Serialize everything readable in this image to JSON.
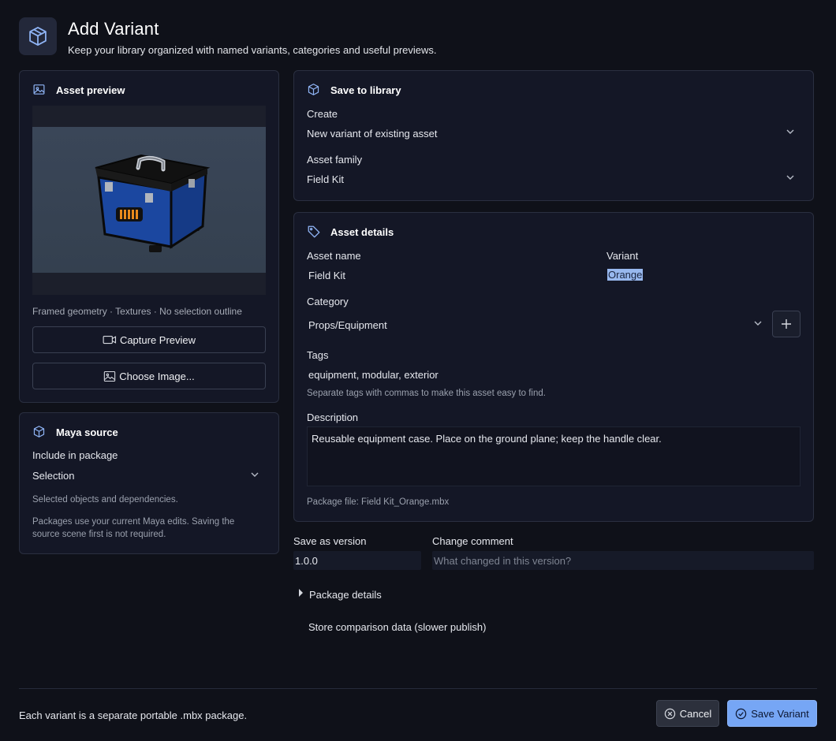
{
  "header": {
    "title": "Add Variant",
    "subtitle": "Keep your library organized with named variants, categories and useful previews.",
    "icon": "package-icon"
  },
  "preview": {
    "title": "Asset preview",
    "icon": "image-icon",
    "caption": "Framed geometry · Textures · No selection outline",
    "capture_label": "Capture Preview",
    "choose_label": "Choose Image..."
  },
  "maya": {
    "title": "Maya source",
    "icon": "package-icon",
    "include_label": "Include in package",
    "include_value": "Selection",
    "hint1": "Selected objects and dependencies.",
    "hint2_line1": "Packages use your current Maya edits. Saving the",
    "hint2_line2": "source scene first is not required."
  },
  "save_to_library": {
    "title": "Save to library",
    "icon": "package-icon",
    "create_label": "Create",
    "create_value": "New variant of existing asset",
    "family_label": "Asset family",
    "family_value": "Field Kit"
  },
  "details": {
    "title": "Asset details",
    "icon": "tag-icon",
    "name_label": "Asset name",
    "name_value": "Field Kit",
    "variant_label": "Variant",
    "variant_value": "Orange",
    "category_label": "Category",
    "category_value": "Props/Equipment",
    "tags_label": "Tags",
    "tags_value": "equipment, modular, exterior",
    "tags_hint": "Separate tags with commas to make this asset easy to find.",
    "description_label": "Description",
    "description_value": "Reusable equipment case. Place on the ground plane; keep the handle clear.",
    "package_file": "Package file: Field Kit_Orange.mbx"
  },
  "version": {
    "label": "Save as version",
    "value": "1.0.0",
    "comment_label": "Change comment",
    "comment_placeholder": "What changed in this version?"
  },
  "package_details_label": "Package details",
  "store_comparison_label": "Store comparison data (slower publish)",
  "footer": {
    "note": "Each variant is a separate portable .mbx package.",
    "cancel_label": "Cancel",
    "save_label": "Save Variant"
  },
  "colors": {
    "accent": "#76a6f5",
    "background": "#0f1119",
    "card": "#141726"
  }
}
